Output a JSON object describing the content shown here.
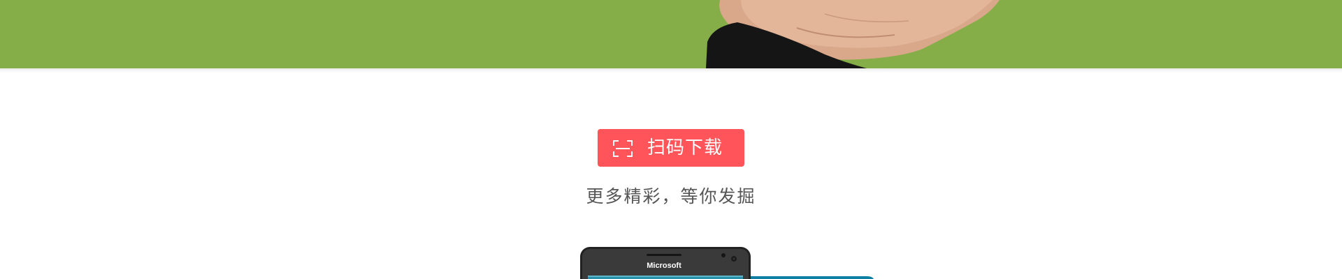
{
  "banner": {
    "color": "#85ad48"
  },
  "download": {
    "button_label": "扫码下载",
    "button_color": "#ff5459",
    "icon": "scan-qr-icon",
    "tagline": "更多精彩，等你发掘"
  },
  "phone": {
    "brand": "Microsoft"
  }
}
